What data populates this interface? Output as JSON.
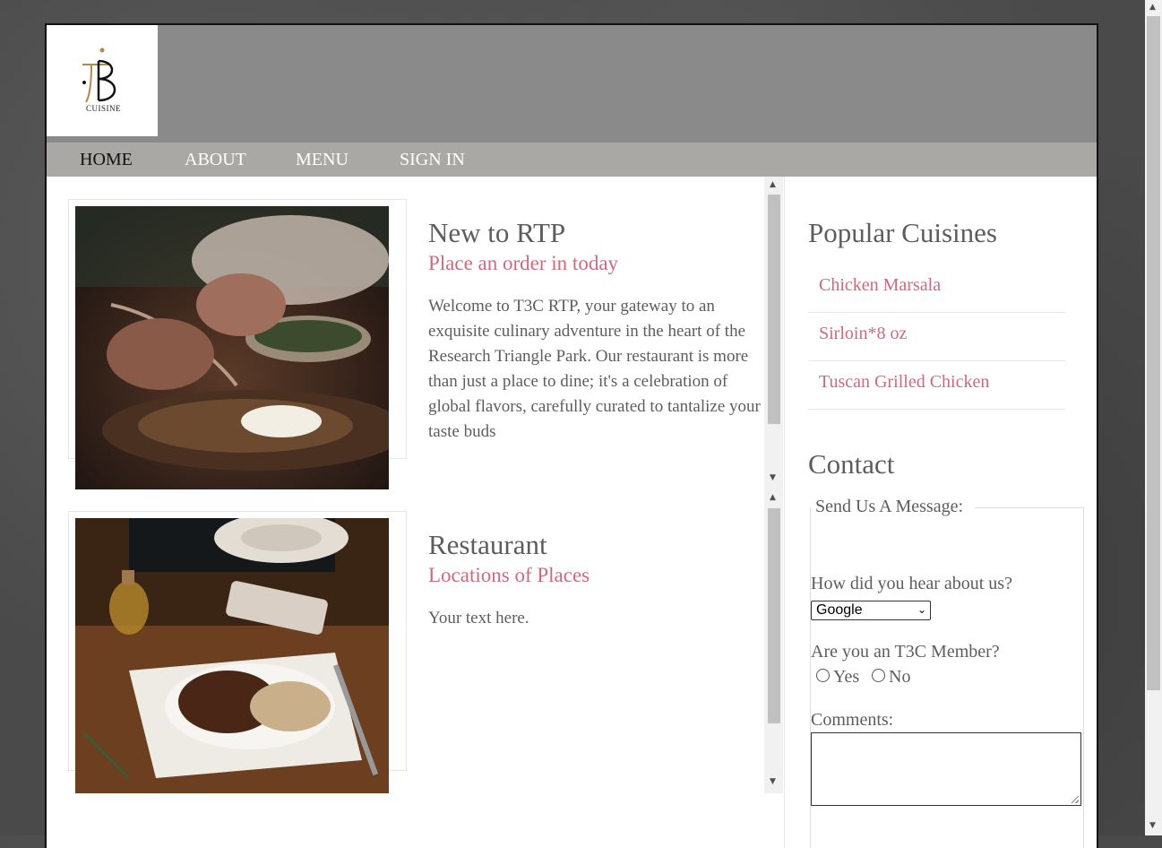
{
  "logo": {
    "text": "CUISINE",
    "letter": "B"
  },
  "nav": {
    "items": [
      "HOME",
      "ABOUT",
      "MENU",
      "SIGN IN"
    ]
  },
  "articles": [
    {
      "title": "New to RTP",
      "subtitle": "Place an order in today",
      "body": "Welcome to T3C RTP, your gateway to an exquisite culinary adventure in the heart of the Research Triangle Park. Our restaurant is more than just a place to dine; it's a celebration of global flavors, carefully curated to tantalize your taste buds"
    },
    {
      "title": "Restaurant",
      "subtitle": "Locations of Places",
      "body": "Your text here."
    }
  ],
  "sidebar": {
    "popular_title": "Popular Cuisines",
    "popular_items": [
      "Chicken Marsala",
      "Sirloin*8 oz",
      "Tuscan Grilled Chicken"
    ],
    "contact_title": "Contact",
    "form": {
      "legend": "Send Us A Message:",
      "hear_label": "How did you hear about us?",
      "hear_value": "Google",
      "member_label": "Are you an T3C Member?",
      "yes": "Yes",
      "no": "No",
      "comments_label": "Comments:"
    }
  },
  "colors": {
    "accent": "#cc6a7e",
    "header": "#8a8a8a",
    "nav": "#a9a8a4",
    "text": "#5d5d5d"
  },
  "icons": [
    "scroll-up-arrow-icon",
    "scroll-down-arrow-icon",
    "chevron-down-icon"
  ]
}
